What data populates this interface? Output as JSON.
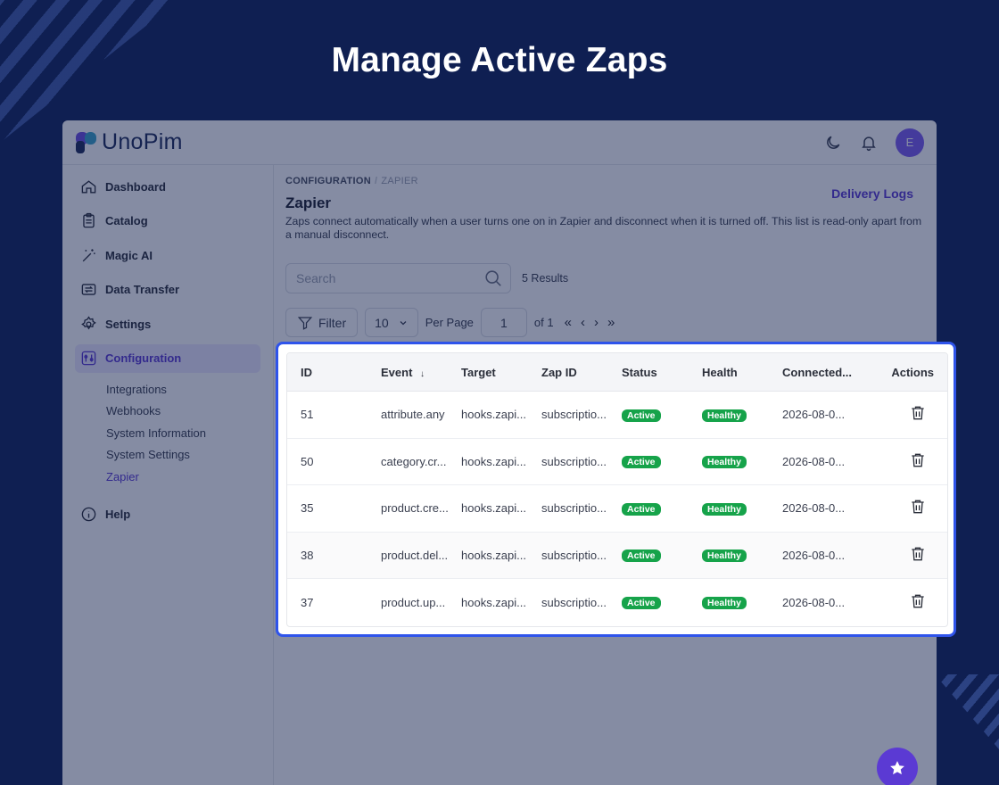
{
  "hero_title": "Manage Active Zaps",
  "app": {
    "logo_text": "UnoPim",
    "avatar_initial": "E",
    "sidebar": {
      "items": [
        {
          "label": "Dashboard",
          "icon": "home-icon"
        },
        {
          "label": "Catalog",
          "icon": "clipboard-icon"
        },
        {
          "label": "Magic AI",
          "icon": "magic-wand-icon"
        },
        {
          "label": "Data Transfer",
          "icon": "transfer-icon"
        },
        {
          "label": "Settings",
          "icon": "gear-icon"
        },
        {
          "label": "Configuration",
          "icon": "sliders-icon",
          "active": true
        }
      ],
      "sub_items": [
        "Integrations",
        "Webhooks",
        "System Information",
        "System Settings",
        "Zapier"
      ],
      "help": "Help"
    },
    "breadcrumb": {
      "parent": "CONFIGURATION",
      "current": "ZAPIER"
    },
    "page_title": "Zapier",
    "delivery_logs": "Delivery Logs",
    "description": "Zaps connect automatically when a user turns one on in Zapier and disconnect when it is turned off. This list is read-only apart from a manual disconnect.",
    "search_placeholder": "Search",
    "results": "5 Results",
    "filter_label": "Filter",
    "per_page_value": "10",
    "per_page_label": "Per Page",
    "page_value": "1",
    "page_of": "of 1"
  },
  "table": {
    "headers": {
      "id": "ID",
      "event": "Event",
      "target": "Target",
      "zap_id": "Zap ID",
      "status": "Status",
      "health": "Health",
      "connected": "Connected...",
      "actions": "Actions"
    },
    "sort_indicator": "↓",
    "rows": [
      {
        "id": "51",
        "event": "attribute.any",
        "target": "hooks.zapi...",
        "zap_id": "subscriptio...",
        "status": "Active",
        "health": "Healthy",
        "connected": "2026-08-0..."
      },
      {
        "id": "50",
        "event": "category.cr...",
        "target": "hooks.zapi...",
        "zap_id": "subscriptio...",
        "status": "Active",
        "health": "Healthy",
        "connected": "2026-08-0..."
      },
      {
        "id": "35",
        "event": "product.cre...",
        "target": "hooks.zapi...",
        "zap_id": "subscriptio...",
        "status": "Active",
        "health": "Healthy",
        "connected": "2026-08-0..."
      },
      {
        "id": "38",
        "event": "product.del...",
        "target": "hooks.zapi...",
        "zap_id": "subscriptio...",
        "status": "Active",
        "health": "Healthy",
        "connected": "2026-08-0..."
      },
      {
        "id": "37",
        "event": "product.up...",
        "target": "hooks.zapi...",
        "zap_id": "subscriptio...",
        "status": "Active",
        "health": "Healthy",
        "connected": "2026-08-0..."
      }
    ]
  },
  "colors": {
    "background": "#0f1f52",
    "accent": "#5b3ad3",
    "highlight_border": "#2f54eb",
    "badge_green": "#16a34a"
  }
}
